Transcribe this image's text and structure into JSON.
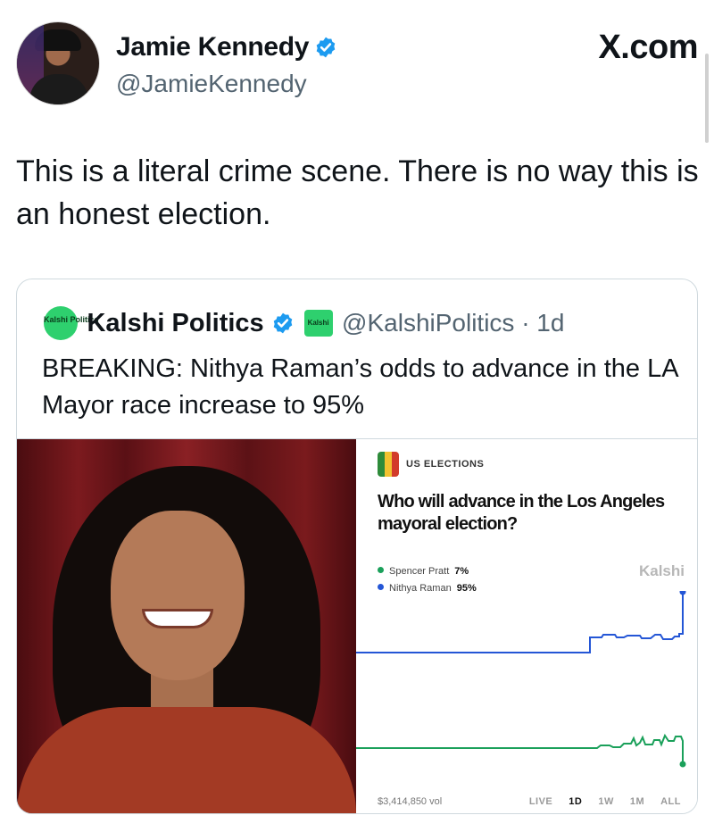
{
  "author": {
    "name": "Jamie Kennedy",
    "handle": "@JamieKennedy",
    "verified_icon": "verified-badge-icon"
  },
  "site_label": "X.com",
  "tweet_text": "This is a literal crime scene. There is no way this is an honest election.",
  "quoted": {
    "avatar_text": "Kalshi Politics",
    "name": "Kalshi Politics",
    "small_logo_text": "Kalshi",
    "handle_time": "@KalshiPolitics · 1d",
    "text": "BREAKING: Nithya Raman’s odds to advance in the LA Mayor race increase to 95%"
  },
  "market_card": {
    "category": "US ELECTIONS",
    "question": "Who will advance in the Los Angeles mayoral election?",
    "brand": "Kalshi",
    "legend": [
      {
        "name": "Spencer Pratt",
        "value": "7%",
        "color": "#1aa05a"
      },
      {
        "name": "Nithya Raman",
        "value": "95%",
        "color": "#2456d6"
      }
    ],
    "volume": "$3,414,850 vol",
    "ranges": [
      "LIVE",
      "1D",
      "1W",
      "1M",
      "ALL"
    ],
    "active_range": "1D"
  },
  "colors": {
    "accent_blue": "#1d9bf0",
    "kalshi_green": "#2ed06e"
  }
}
